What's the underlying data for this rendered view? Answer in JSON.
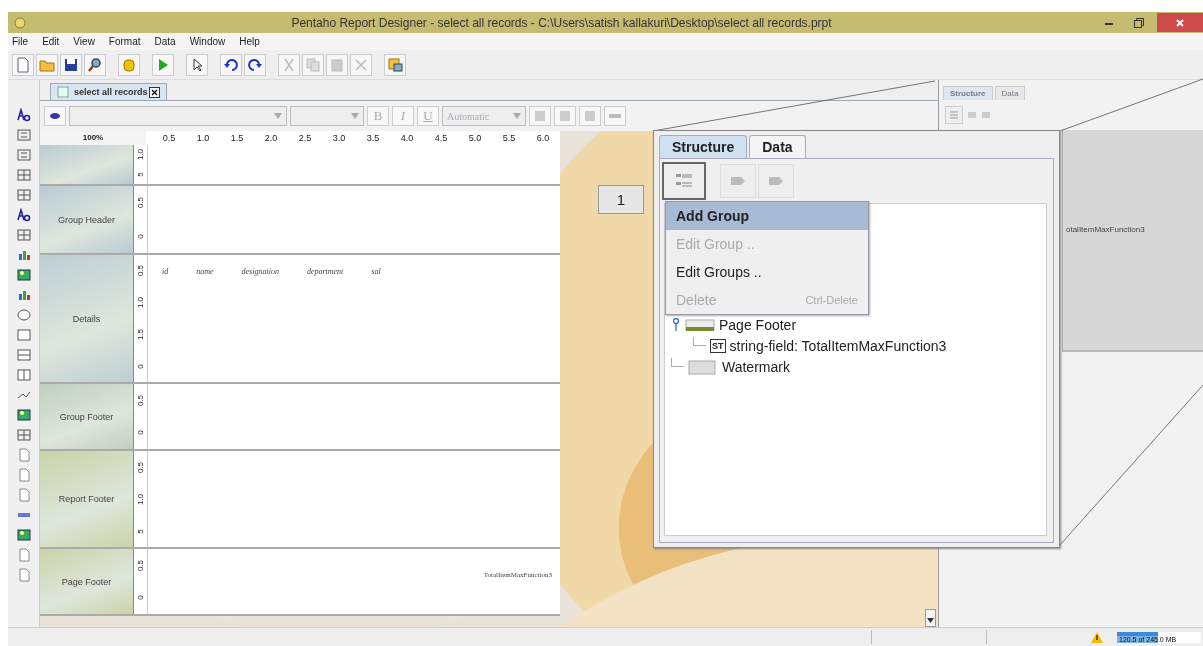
{
  "window": {
    "title": "Pentaho Report Designer - select all records - C:\\Users\\satish kallakuri\\Desktop\\select all records.prpt"
  },
  "menu": [
    "File",
    "Edit",
    "View",
    "Format",
    "Data",
    "Window",
    "Help"
  ],
  "document_tab": {
    "label": "select all records"
  },
  "format_toolbar": {
    "bold": "B",
    "italic": "I",
    "underline": "U",
    "font_color": "Automatic"
  },
  "zoom": "100%",
  "ruler": [
    "0.5",
    "1.0",
    "1.5",
    "2.0",
    "2.5",
    "3.0",
    "3.5",
    "4.0",
    "4.5",
    "5.0",
    "5.5",
    "6.0"
  ],
  "bands": [
    {
      "ruler": [
        "1.0",
        "5"
      ]
    },
    {
      "label": "Group Header",
      "ruler": [
        "0.5",
        "0"
      ]
    },
    {
      "label": "Details",
      "ruler": [
        "0.5",
        "1.0",
        "1.5",
        "0"
      ],
      "fields": [
        "id",
        "name",
        "designation",
        "department",
        "sal"
      ]
    },
    {
      "label": "Group Footer",
      "ruler": [
        "0.5",
        "0"
      ]
    },
    {
      "label": "Report Footer",
      "ruler": [
        "0.5",
        "1.0",
        "5"
      ]
    },
    {
      "label": "Page Footer",
      "ruler": [
        "0.5",
        "0"
      ],
      "right_field": "TotalItemMaxFunction3"
    }
  ],
  "right_panel": {
    "tabs": [
      {
        "label": "Structure",
        "selected": true
      },
      {
        "label": "Data",
        "selected": false
      }
    ],
    "preview_text": "otalItemMaxFunction3"
  },
  "callout": {
    "number": "1",
    "tabs": [
      {
        "label": "Structure",
        "selected": true
      },
      {
        "label": "Data",
        "selected": false
      }
    ],
    "menu": [
      {
        "label": "Add Group",
        "selected": true,
        "disabled": false
      },
      {
        "label": "Edit Group ..",
        "selected": false,
        "disabled": true
      },
      {
        "label": "Edit Groups ..",
        "selected": false,
        "disabled": false
      },
      {
        "label": "Delete",
        "shortcut": "Ctrl-Delete",
        "selected": false,
        "disabled": true
      }
    ],
    "tree": [
      {
        "label": "Page Footer",
        "kind": "band",
        "expanded": true,
        "children": [
          {
            "label": "string-field: TotalItemMaxFunction3",
            "badge": "ST"
          }
        ]
      },
      {
        "label": "Watermark",
        "kind": "watermark"
      }
    ]
  },
  "status_bar": {
    "memory": "120.5 of 245.0 MB",
    "level": 0.49
  }
}
